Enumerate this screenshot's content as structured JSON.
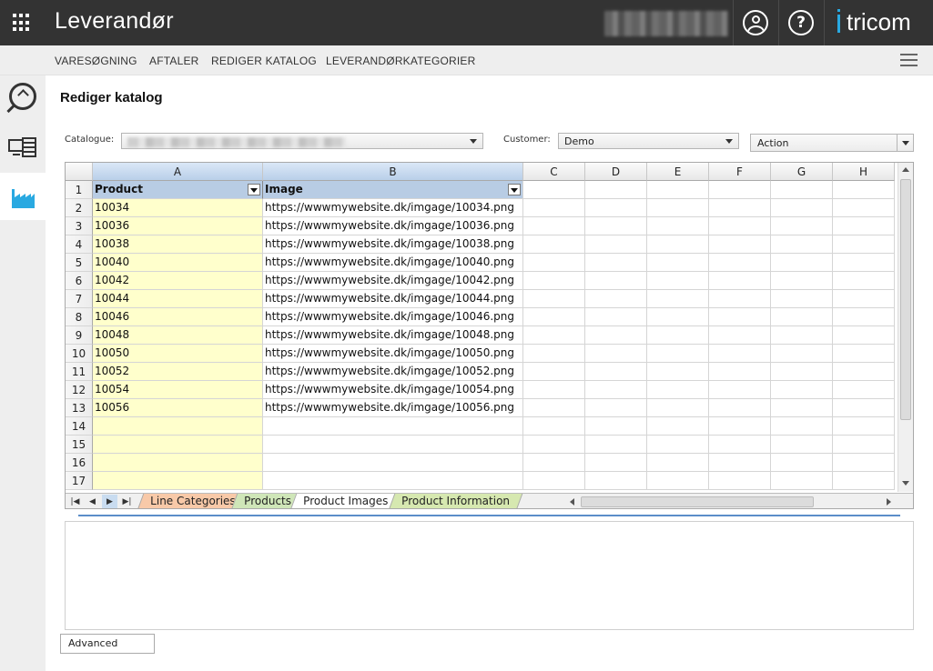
{
  "header": {
    "title": "Leverandør",
    "brand": "tricom",
    "icons": [
      "apps-grid-icon",
      "user-circle-icon",
      "help-circle-icon"
    ]
  },
  "nav": {
    "items": [
      "VARESØGNING",
      "AFTALER",
      "REDIGER KATALOG",
      "LEVERANDØRKATEGORIER"
    ]
  },
  "sidebar": {
    "icons": [
      "search-icon",
      "catalog-icon",
      "factory-icon"
    ],
    "active": "factory-icon"
  },
  "page": {
    "title": "Rediger katalog"
  },
  "filters": {
    "catalogue_label": "Catalogue:",
    "customer_label": "Customer:",
    "customer_value": "Demo",
    "action_value": "Action"
  },
  "grid": {
    "columns": [
      "A",
      "B",
      "C",
      "D",
      "E",
      "F",
      "G",
      "H"
    ],
    "selected_columns": [
      "A",
      "B"
    ],
    "row_numbers": [
      "1",
      "2",
      "3",
      "4",
      "5",
      "6",
      "7",
      "8",
      "9",
      "10",
      "11",
      "12",
      "13",
      "14",
      "15",
      "16",
      "17"
    ],
    "header_row": [
      "Product",
      "Image"
    ],
    "rows": [
      [
        "10034",
        "https://wwwmywebsite.dk/imgage/10034.png"
      ],
      [
        "10036",
        "https://wwwmywebsite.dk/imgage/10036.png"
      ],
      [
        "10038",
        "https://wwwmywebsite.dk/imgage/10038.png"
      ],
      [
        "10040",
        "https://wwwmywebsite.dk/imgage/10040.png"
      ],
      [
        "10042",
        "https://wwwmywebsite.dk/imgage/10042.png"
      ],
      [
        "10044",
        "https://wwwmywebsite.dk/imgage/10044.png"
      ],
      [
        "10046",
        "https://wwwmywebsite.dk/imgage/10046.png"
      ],
      [
        "10048",
        "https://wwwmywebsite.dk/imgage/10048.png"
      ],
      [
        "10050",
        "https://wwwmywebsite.dk/imgage/10050.png"
      ],
      [
        "10052",
        "https://wwwmywebsite.dk/imgage/10052.png"
      ],
      [
        "10054",
        "https://wwwmywebsite.dk/imgage/10054.png"
      ],
      [
        "10056",
        "https://wwwmywebsite.dk/imgage/10056.png"
      ]
    ],
    "tabs": [
      {
        "label": "Line Categories",
        "color": "#f8c9a8",
        "active": false
      },
      {
        "label": "Products",
        "color": "#cfe6b8",
        "active": false
      },
      {
        "label": "Product Images",
        "color": "#ffffff",
        "active": true
      },
      {
        "label": "Product Information",
        "color": "#d6e8b0",
        "active": false
      }
    ],
    "column_a_color": "#ffffcc",
    "header_color": "#b8cce4"
  },
  "footer": {
    "advanced_label": "Advanced"
  },
  "colors": {
    "topbar": "#333333",
    "accent": "#29a9e1",
    "splitter": "#5b8dc9"
  }
}
